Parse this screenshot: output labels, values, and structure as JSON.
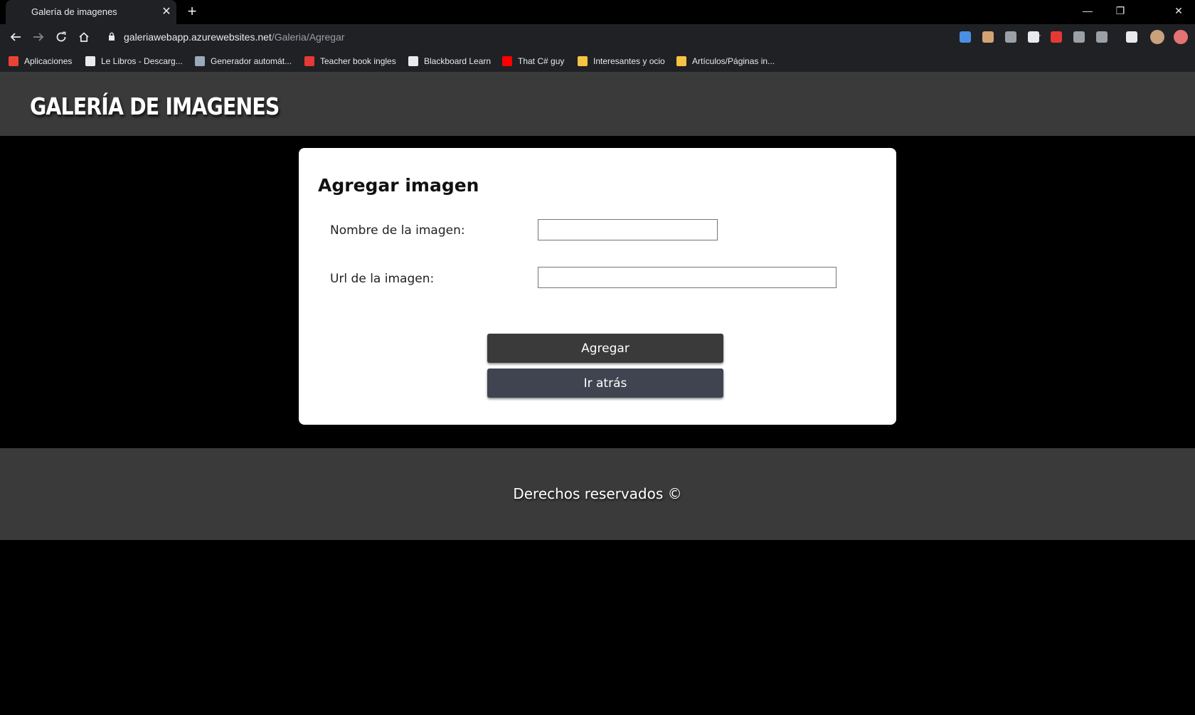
{
  "browser": {
    "tab_title": "Galería de imagenes",
    "tab_close": "✕",
    "new_tab": "+",
    "url_host": "galeriawebapp.azurewebsites.net",
    "url_path": "/Galeria/Agregar",
    "window_controls": {
      "minimize": "—",
      "restore": "❐",
      "close": "✕"
    },
    "extension_icons": [
      "shield-icon",
      "extension-icon",
      "speaker-icon",
      "chat-icon",
      "adblock-icon",
      "drive-icon",
      "extension-icon",
      "reading-list-icon",
      "avatar",
      "update-icon"
    ],
    "bookmarks": [
      {
        "label": "Aplicaciones",
        "icon": "apps-grid-icon",
        "color": "#ea4335"
      },
      {
        "label": "Le Libros - Descarg...",
        "icon": "globe-icon",
        "color": "#e8eaed"
      },
      {
        "label": "Generador automát...",
        "icon": "document-icon",
        "color": "#9ab"
      },
      {
        "label": "Teacher book ingles",
        "icon": "target-icon",
        "color": "#e53935"
      },
      {
        "label": "Blackboard Learn",
        "icon": "blackboard-icon",
        "color": "#e8eaed"
      },
      {
        "label": "That C# guy",
        "icon": "youtube-icon",
        "color": "#ff0000"
      },
      {
        "label": "Interesantes y ocio",
        "icon": "folder-icon",
        "color": "#f6c344"
      },
      {
        "label": "Artículos/Páginas in...",
        "icon": "folder-icon",
        "color": "#f6c344"
      }
    ]
  },
  "header": {
    "title": "GALERÍA DE IMAGENES"
  },
  "form": {
    "title": "Agregar imagen",
    "name_label": "Nombre de la imagen:",
    "name_value": "",
    "url_label": "Url de la imagen:",
    "url_value": "",
    "submit_label": "Agregar",
    "back_label": "Ir atrás"
  },
  "footer": {
    "text": "Derechos reservados ©"
  }
}
